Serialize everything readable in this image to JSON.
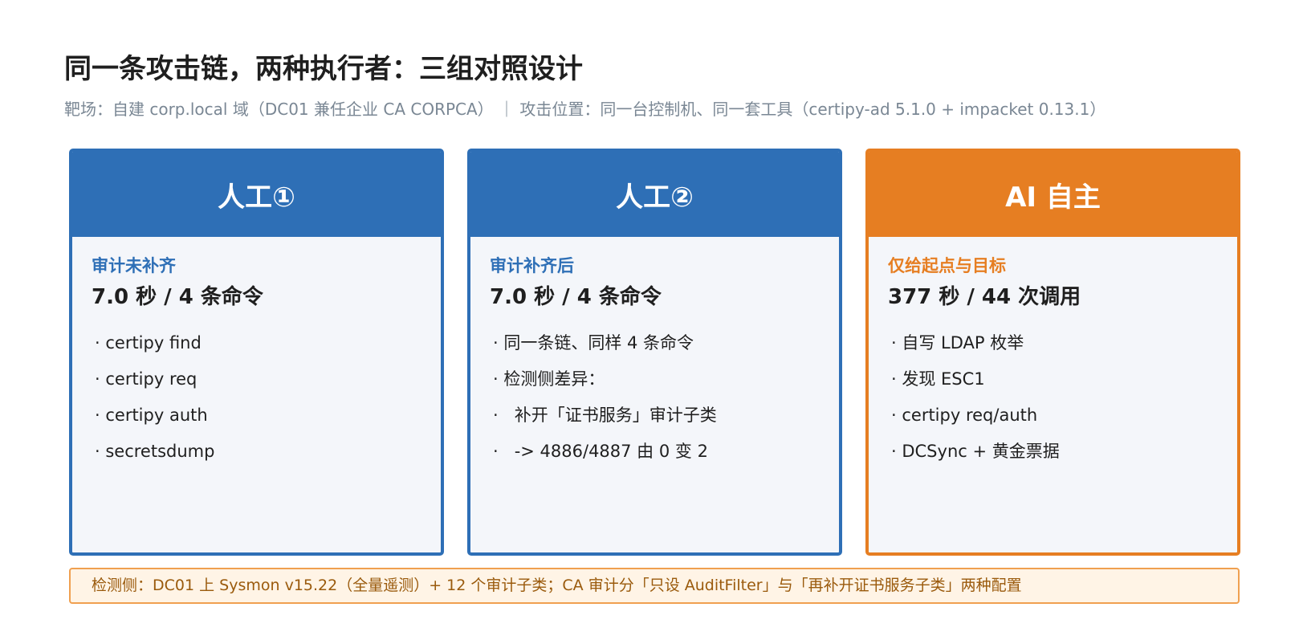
{
  "title": "同一条攻击链，两种执行者：三组对照设计",
  "subtitle": "靶场：自建 corp.local 域（DC01 兼任企业 CA CORPCA）  ｜  攻击位置：同一台控制机、同一套工具（certipy-ad 5.1.0 + impacket 0.13.1）",
  "cards": [
    {
      "header": "人工①",
      "tag": "审计未补齐",
      "stat": "7.0 秒 / 4 条命令",
      "items": [
        "· certipy find",
        "· certipy req",
        "· certipy auth",
        "· secretsdump"
      ]
    },
    {
      "header": "人工②",
      "tag": "审计补齐后",
      "stat": "7.0 秒 / 4 条命令",
      "items": [
        "· 同一条链、同样 4 条命令",
        "· 检测侧差异：",
        "·   补开「证书服务」审计子类",
        "·   -> 4886/4887 由 0 变 2"
      ]
    },
    {
      "header": "AI 自主",
      "tag": "仅给起点与目标",
      "stat": "377 秒 / 44 次调用",
      "items": [
        "· 自写 LDAP 枚举",
        "· 发现 ESC1",
        "· certipy req/auth",
        "· DCSync + 黄金票据"
      ]
    }
  ],
  "footer": "检测侧：DC01 上 Sysmon v15.22（全量遥测）+ 12 个审计子类；CA 审计分「只设 AuditFilter」与「再补开证书服务子类」两种配置",
  "colors": {
    "blue": "#2e6fb6",
    "orange": "#e67e22",
    "card_bg": "#f4f6fa",
    "footer_bg": "#fff4e6",
    "footer_text": "#9a5a0c"
  }
}
